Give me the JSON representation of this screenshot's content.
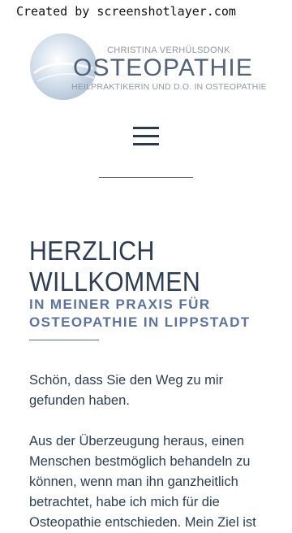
{
  "watermark": {
    "text": "Created by screenshotlayer.com"
  },
  "logo": {
    "line1": "CHRISTINA VERHÜLSDONK",
    "line2": "OSTEOPATHIE",
    "line3": "HEILPRAKTIKERIN UND D.O. IN OSTEOPATHIE"
  },
  "nav": {
    "menu_icon": "hamburger-menu-icon"
  },
  "main": {
    "heading_lines": [
      "HERZLICH",
      "WILLKOMMEN"
    ],
    "subheading_lines": [
      "IN MEINER PRAXIS FÜR",
      "OSTEOPATHIE IN LIPPSTADT"
    ],
    "paragraph1_lines": [
      "Schön, dass Sie den Weg zu mir",
      "gefunden haben."
    ],
    "paragraph2_lines": [
      "Aus der Überzeugung heraus, einen",
      "Menschen bestmöglich behandeln zu",
      "können, wenn man ihn ganzheitlich",
      "betrachtet, habe ich mich für die",
      "Osteopathie entschieden. Mein Ziel ist"
    ]
  },
  "colors": {
    "heading": "#2d3d55",
    "subheading": "#5a73a0",
    "divider": "#5b6d86",
    "logo_main": "#51627a",
    "logo_sub": "#8e98a6"
  }
}
